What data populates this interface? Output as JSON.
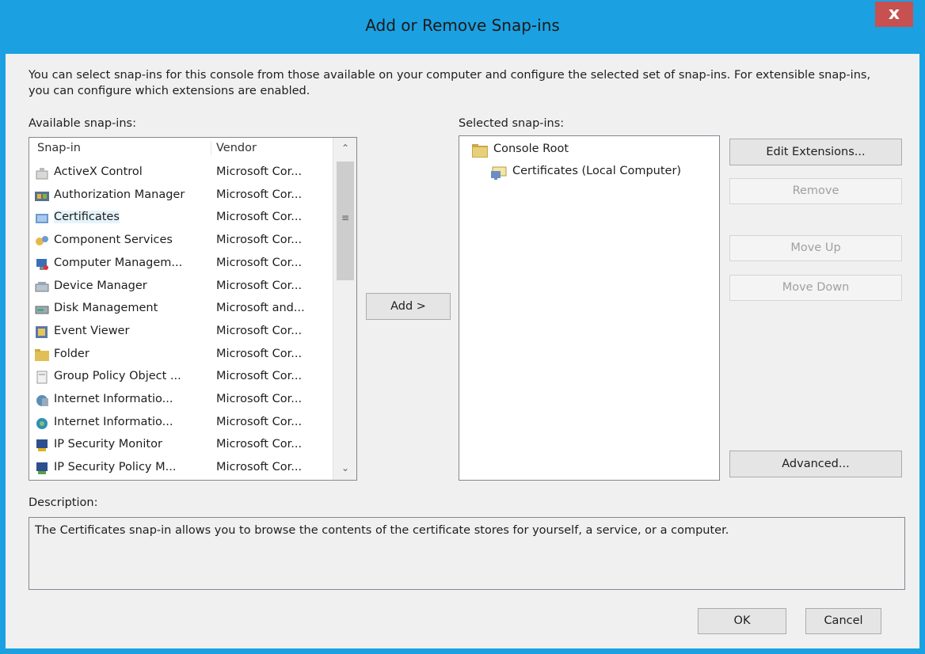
{
  "dialog": {
    "title": "Add or Remove Snap-ins",
    "close_label": "x",
    "intro_text": "You can select snap-ins for this console from those available on your computer and configure the selected set of snap-ins. For extensible snap-ins, you can configure which extensions are enabled."
  },
  "available": {
    "label": "Available snap-ins:",
    "columns": {
      "snapin": "Snap-in",
      "vendor": "Vendor"
    },
    "items": [
      {
        "name": "ActiveX Control",
        "vendor": "Microsoft Cor...",
        "icon": "activex-icon"
      },
      {
        "name": "Authorization Manager",
        "vendor": "Microsoft Cor...",
        "icon": "authorization-manager-icon"
      },
      {
        "name": "Certificates",
        "vendor": "Microsoft Cor...",
        "icon": "certificates-icon",
        "selected": true
      },
      {
        "name": "Component Services",
        "vendor": "Microsoft Cor...",
        "icon": "component-services-icon"
      },
      {
        "name": "Computer Managem...",
        "vendor": "Microsoft Cor...",
        "icon": "computer-management-icon"
      },
      {
        "name": "Device Manager",
        "vendor": "Microsoft Cor...",
        "icon": "device-manager-icon"
      },
      {
        "name": "Disk Management",
        "vendor": "Microsoft and...",
        "icon": "disk-management-icon"
      },
      {
        "name": "Event Viewer",
        "vendor": "Microsoft Cor...",
        "icon": "event-viewer-icon"
      },
      {
        "name": "Folder",
        "vendor": "Microsoft Cor...",
        "icon": "folder-icon"
      },
      {
        "name": "Group Policy Object ...",
        "vendor": "Microsoft Cor...",
        "icon": "group-policy-icon"
      },
      {
        "name": "Internet Informatio...",
        "vendor": "Microsoft Cor...",
        "icon": "iis-icon"
      },
      {
        "name": "Internet Informatio...",
        "vendor": "Microsoft Cor...",
        "icon": "iis6-icon"
      },
      {
        "name": "IP Security Monitor",
        "vendor": "Microsoft Cor...",
        "icon": "ip-security-monitor-icon"
      },
      {
        "name": "IP Security Policy M...",
        "vendor": "Microsoft Cor...",
        "icon": "ip-security-policy-icon"
      }
    ]
  },
  "add_button": "Add >",
  "selected": {
    "label": "Selected snap-ins:",
    "root": "Console Root",
    "child": "Certificates (Local Computer)"
  },
  "buttons": {
    "edit_extensions": "Edit Extensions...",
    "remove": "Remove",
    "move_up": "Move Up",
    "move_down": "Move Down",
    "advanced": "Advanced...",
    "ok": "OK",
    "cancel": "Cancel"
  },
  "description": {
    "label": "Description:",
    "text": "The Certificates snap-in allows you to browse the contents of the certificate stores for yourself, a service, or a computer."
  },
  "colors": {
    "title_bar": "#1ba1e2",
    "close_button": "#c75050",
    "selection": "#e5f3fb"
  }
}
